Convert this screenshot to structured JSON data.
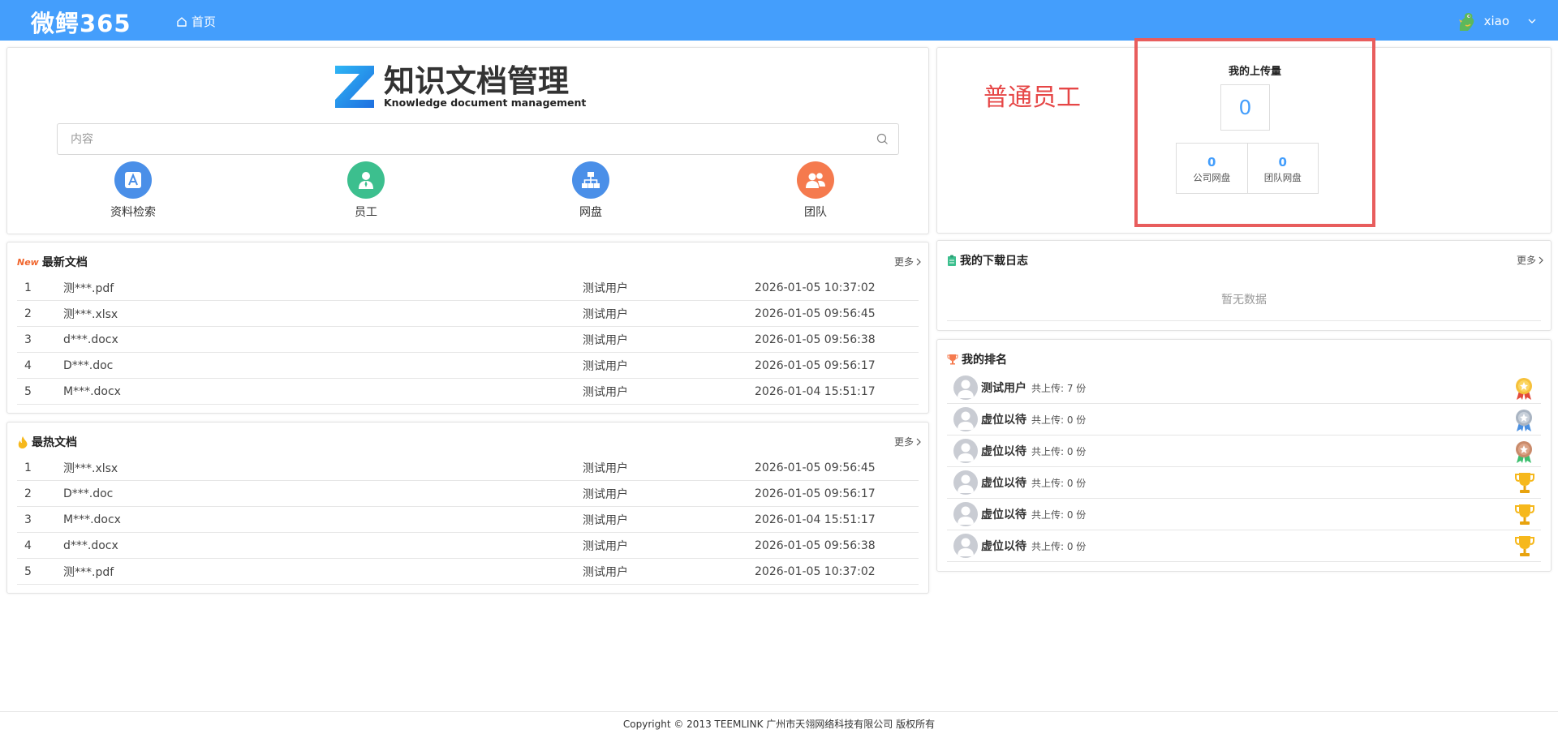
{
  "topbar": {
    "brand": "微鳄365",
    "nav_home": "首页",
    "username": "xiao"
  },
  "search_panel": {
    "logo_title": "知识文档管理",
    "logo_subtitle": "Knowledge document management",
    "search_placeholder": "内容",
    "quick_links": [
      {
        "label": "资料检索",
        "icon": "search-docs-icon",
        "color": "#4a8fe8"
      },
      {
        "label": "员工",
        "icon": "employee-icon",
        "color": "#3cbf8e"
      },
      {
        "label": "网盘",
        "icon": "network-disk-icon",
        "color": "#4a8fe8"
      },
      {
        "label": "团队",
        "icon": "team-icon",
        "color": "#f57a4e"
      }
    ]
  },
  "stats": {
    "role_label": "普通员工",
    "upload_title": "我的上传量",
    "upload_count": "0",
    "company_disk_count": "0",
    "company_disk_label": "公司网盘",
    "team_disk_count": "0",
    "team_disk_label": "团队网盘"
  },
  "latest_docs": {
    "title": "最新文档",
    "badge": "New",
    "more": "更多",
    "rows": [
      {
        "idx": "1",
        "name": "测***.pdf",
        "user": "测试用户",
        "time": "2026-01-05 10:37:02"
      },
      {
        "idx": "2",
        "name": "测***.xlsx",
        "user": "测试用户",
        "time": "2026-01-05 09:56:45"
      },
      {
        "idx": "3",
        "name": "d***.docx",
        "user": "测试用户",
        "time": "2026-01-05 09:56:38"
      },
      {
        "idx": "4",
        "name": "D***.doc",
        "user": "测试用户",
        "time": "2026-01-05 09:56:17"
      },
      {
        "idx": "5",
        "name": "M***.docx",
        "user": "测试用户",
        "time": "2026-01-04 15:51:17"
      }
    ]
  },
  "hot_docs": {
    "title": "最热文档",
    "more": "更多",
    "rows": [
      {
        "idx": "1",
        "name": "测***.xlsx",
        "user": "测试用户",
        "time": "2026-01-05 09:56:45"
      },
      {
        "idx": "2",
        "name": "D***.doc",
        "user": "测试用户",
        "time": "2026-01-05 09:56:17"
      },
      {
        "idx": "3",
        "name": "M***.docx",
        "user": "测试用户",
        "time": "2026-01-04 15:51:17"
      },
      {
        "idx": "4",
        "name": "d***.docx",
        "user": "测试用户",
        "time": "2026-01-05 09:56:38"
      },
      {
        "idx": "5",
        "name": "测***.pdf",
        "user": "测试用户",
        "time": "2026-01-05 10:37:02"
      }
    ]
  },
  "download_log": {
    "title": "我的下载日志",
    "more": "更多",
    "empty_text": "暂无数据"
  },
  "ranking": {
    "title": "我的排名",
    "rows": [
      {
        "name": "测试用户",
        "count": "共上传: 7 份",
        "badge": "gold-medal-icon"
      },
      {
        "name": "虚位以待",
        "count": "共上传: 0 份",
        "badge": "silver-medal-icon"
      },
      {
        "name": "虚位以待",
        "count": "共上传: 0 份",
        "badge": "bronze-medal-icon"
      },
      {
        "name": "虚位以待",
        "count": "共上传: 0 份",
        "badge": "trophy-icon"
      },
      {
        "name": "虚位以待",
        "count": "共上传: 0 份",
        "badge": "trophy-icon"
      },
      {
        "name": "虚位以待",
        "count": "共上传: 0 份",
        "badge": "trophy-icon"
      }
    ]
  },
  "footer": {
    "copyright": "Copyright © 2013 TEEMLINK 广州市天翎网络科技有限公司 版权所有"
  },
  "colors": {
    "topbar": "#449efc",
    "accent_number": "#449efc",
    "role_red": "#e64646",
    "highlight_box": "#e85d5d"
  }
}
